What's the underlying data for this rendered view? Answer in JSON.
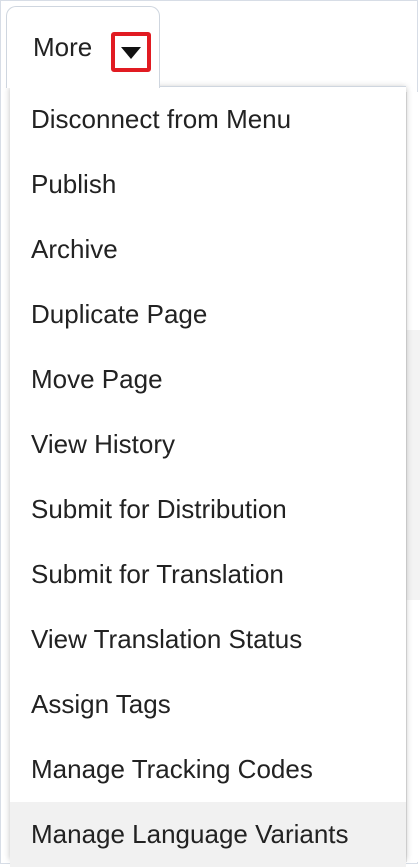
{
  "tab": {
    "label": "More",
    "dropdown_icon": "caret-down-icon"
  },
  "colors": {
    "highlight_border": "#e11b22",
    "hover_background": "#f1f1f1"
  },
  "menu": {
    "items": [
      {
        "label": "Disconnect from Menu"
      },
      {
        "label": "Publish"
      },
      {
        "label": "Archive"
      },
      {
        "label": "Duplicate Page"
      },
      {
        "label": "Move Page"
      },
      {
        "label": "View History"
      },
      {
        "label": "Submit for Distribution"
      },
      {
        "label": "Submit for Translation"
      },
      {
        "label": "View Translation Status"
      },
      {
        "label": "Assign Tags"
      },
      {
        "label": "Manage Tracking Codes"
      },
      {
        "label": "Manage Language Variants",
        "highlighted": true
      }
    ]
  }
}
